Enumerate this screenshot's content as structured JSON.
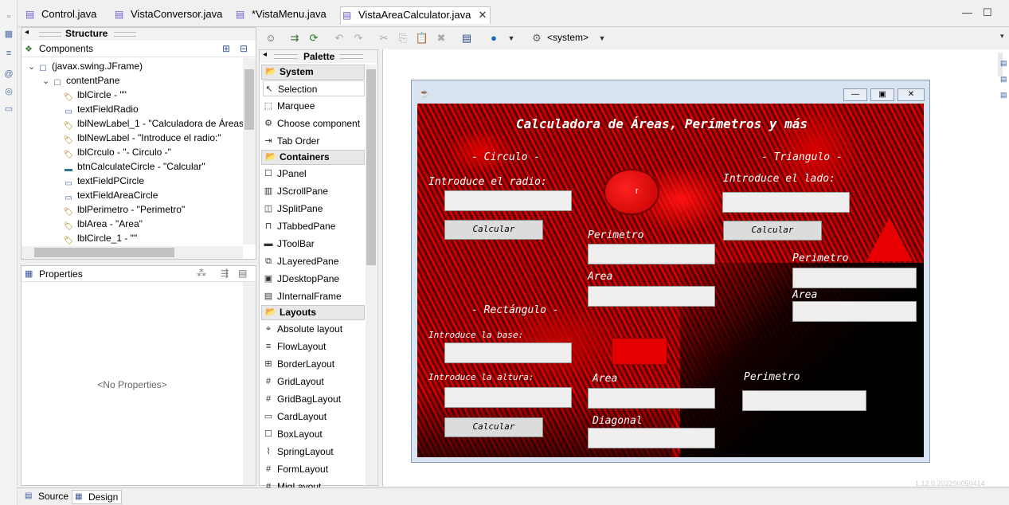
{
  "editor_tabs": [
    {
      "label": "Control.java",
      "active": false
    },
    {
      "label": "VistaConversor.java",
      "active": false
    },
    {
      "label": "*VistaMenu.java",
      "active": false
    },
    {
      "label": "VistaAreaCalculator.java",
      "active": true
    }
  ],
  "structure": {
    "title": "Structure",
    "components_label": "Components",
    "tree": [
      "(javax.swing.JFrame)",
      "contentPane",
      "lblCircle - \"\"",
      "textFieldRadio",
      "lblNewLabel_1 - \"Calculadora de Áreas",
      "lblNewLabel - \"Introduce el radio:\"",
      "lblCrculo - \"- Circulo -\"",
      "btnCalculateCircle - \"Calcular\"",
      "textFieldPCircle",
      "textFieldAreaCircle",
      "lblPerimetro - \"Perimetro\"",
      "lblArea - \"Area\"",
      "lblCircle_1 - \"\""
    ]
  },
  "properties": {
    "title": "Properties",
    "empty_text": "<No Properties>"
  },
  "toolbar": {
    "system_combo": "<system>"
  },
  "palette": {
    "title": "Palette",
    "sections": [
      {
        "name": "System",
        "items": [
          "Selection",
          "Marquee",
          "Choose component",
          "Tab Order"
        ]
      },
      {
        "name": "Containers",
        "items": [
          "JPanel",
          "JScrollPane",
          "JSplitPane",
          "JTabbedPane",
          "JToolBar",
          "JLayeredPane",
          "JDesktopPane",
          "JInternalFrame"
        ]
      },
      {
        "name": "Layouts",
        "items": [
          "Absolute layout",
          "FlowLayout",
          "BorderLayout",
          "GridLayout",
          "GridBagLayout",
          "CardLayout",
          "BoxLayout",
          "SpringLayout",
          "FormLayout",
          "MigLayout"
        ]
      }
    ]
  },
  "form": {
    "title": "Calculadora de Áreas, Perímetros y más",
    "circle": {
      "heading": "- Circulo -",
      "prompt": "Introduce el radio:",
      "button": "Calcular",
      "perimeter_label": "Perimetro",
      "area_label": "Area",
      "radius_mark": "r"
    },
    "triangle": {
      "heading": "- Triangulo -",
      "prompt": "Introduce el lado:",
      "button": "Calcular",
      "perimeter_label": "Perimetro",
      "area_label": "Area"
    },
    "rectangle": {
      "heading": "- Rectángulo -",
      "base_prompt": "Introduce la base:",
      "height_prompt": "Introduce la altura:",
      "button": "Calcular",
      "area_label": "Area",
      "diagonal_label": "Diagonal",
      "perimeter_label": "Perimetro"
    }
  },
  "version": "1.12.0.202200050414",
  "bottom_tabs": [
    "Source",
    "Design"
  ],
  "colors": {
    "accent_red": "#e00000",
    "canvas_bg": "#ffffff"
  }
}
